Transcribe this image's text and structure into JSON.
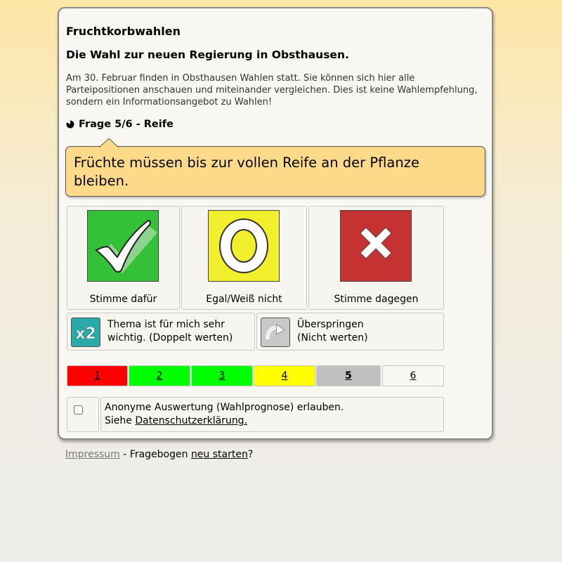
{
  "app": {
    "title": "Fruchtkorbwahlen",
    "subtitle": "Die Wahl zur neuen Regierung in Obsthausen.",
    "intro": "Am 30. Februar finden in Obsthausen Wahlen statt. Sie können sich hier alle Parteipositionen anschauen und miteinander vergleichen. Dies ist keine Wahlempfehlung, sondern ein Informationsangebot zu Wahlen!"
  },
  "question": {
    "heading": "Frage 5/6 - Reife",
    "text": "Früchte müssen bis zur vollen Reife an der Pflanze bleiben.",
    "progress_fraction": 0.833
  },
  "answers": [
    {
      "label": "Stimme dafür",
      "icon": "checkmark-icon",
      "color": "#33c237"
    },
    {
      "label": "Egal/Weiß nicht",
      "icon": "neutral-circle-icon",
      "color": "#f2ef2e"
    },
    {
      "label": "Stimme dagegen",
      "icon": "cross-icon",
      "color": "#c63232"
    }
  ],
  "extra_options": {
    "double": {
      "line1": "Thema ist für mich sehr",
      "line2": "wichtig. (Doppelt werten)",
      "icon_text": "x2",
      "color": "#2aa9a8"
    },
    "skip": {
      "line1": "Überspringen",
      "line2": "(Nicht werten)",
      "icon": "skip-arrow-icon"
    }
  },
  "pager": [
    {
      "label": "1",
      "color": "#ff0000",
      "current": false
    },
    {
      "label": "2",
      "color": "#00ff00",
      "current": false
    },
    {
      "label": "3",
      "color": "#00ff00",
      "current": false
    },
    {
      "label": "4",
      "color": "#ffff00",
      "current": false
    },
    {
      "label": "5",
      "color": "#c0c0c0",
      "current": true
    },
    {
      "label": "6",
      "color": "#f8f7f2",
      "current": false
    }
  ],
  "consent": {
    "line1": "Anonyme Auswertung (Wahlprognose) erlauben.",
    "line2_prefix": "Siehe ",
    "link": "Datenschutzerklärung.",
    "checked": false
  },
  "footer": {
    "impressum": "Impressum",
    "middle": " - Fragebogen ",
    "restart": "neu starten",
    "suffix": "?"
  }
}
